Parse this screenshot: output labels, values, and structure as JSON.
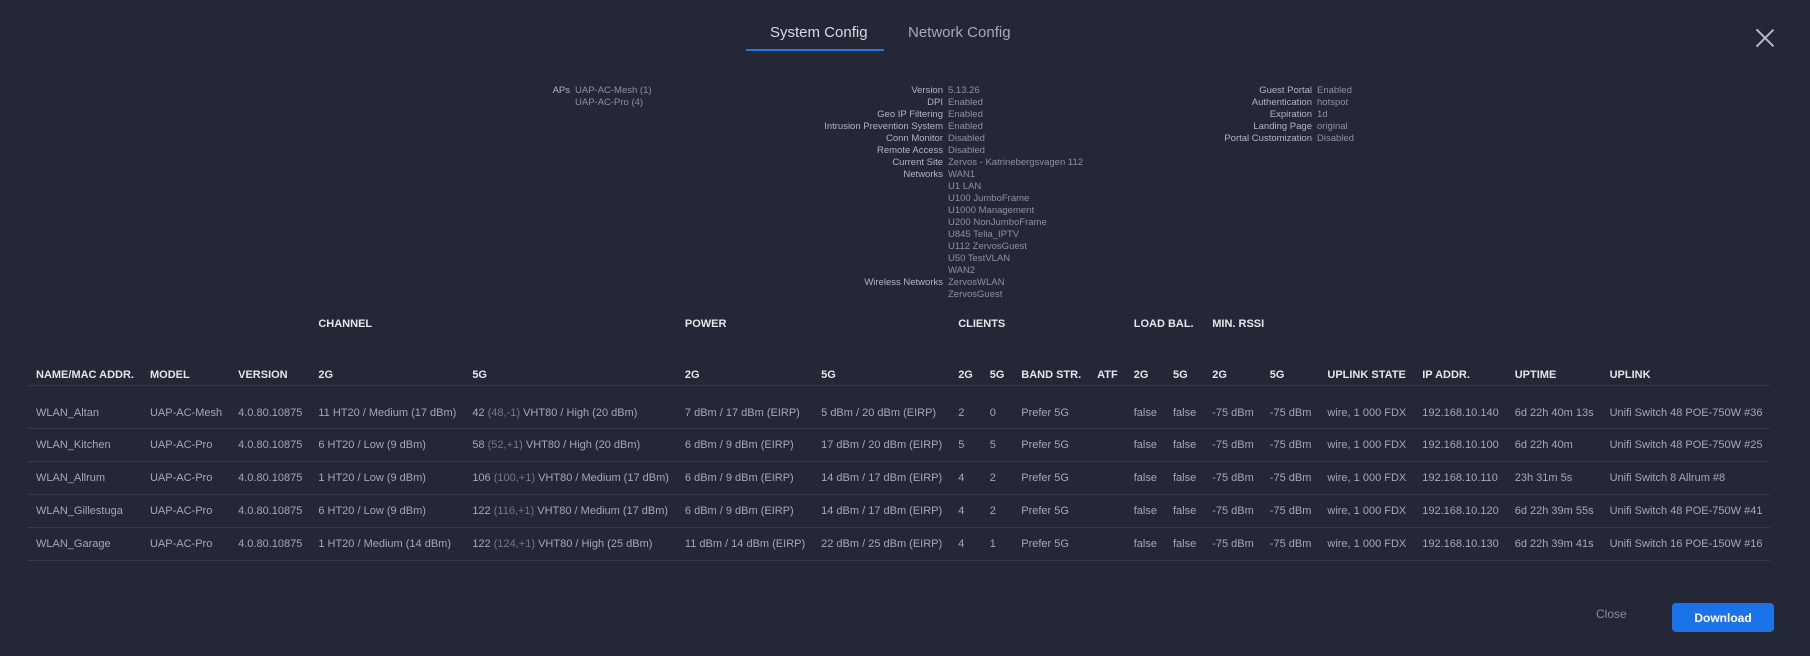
{
  "tabs": {
    "system": "System Config",
    "network": "Network Config"
  },
  "info_left": [
    {
      "key": "APs",
      "values": [
        "UAP-AC-Mesh (1)",
        "UAP-AC-Pro (4)"
      ]
    }
  ],
  "info_middle": [
    {
      "key": "Version",
      "values": [
        "5.13.26"
      ]
    },
    {
      "key": "DPI",
      "values": [
        "Enabled"
      ]
    },
    {
      "key": "Geo IP Filtering",
      "values": [
        "Enabled"
      ]
    },
    {
      "key": "Intrusion Prevention System",
      "values": [
        "Enabled"
      ]
    },
    {
      "key": "Conn Monitor",
      "values": [
        "Disabled"
      ]
    },
    {
      "key": "Remote Access",
      "values": [
        "Disabled"
      ]
    },
    {
      "key": "Current Site",
      "values": [
        "Zervos - Katrinebergsvagen 112"
      ]
    },
    {
      "key": "Networks",
      "values": [
        "WAN1",
        "U1 LAN",
        "U100 JumboFrame",
        "U1000 Management",
        "U200 NonJumboFrame",
        "U845 Telia_IPTV",
        "U112 ZervosGuest",
        "U50 TestVLAN",
        "WAN2"
      ]
    },
    {
      "key": "Wireless Networks",
      "values": [
        "ZervosWLAN",
        "ZervosGuest"
      ]
    }
  ],
  "info_right": [
    {
      "key": "Guest Portal",
      "values": [
        "Enabled"
      ]
    },
    {
      "key": "Authentication",
      "values": [
        "hotspot"
      ]
    },
    {
      "key": "Expiration",
      "values": [
        "1d"
      ]
    },
    {
      "key": "Landing Page",
      "values": [
        "original"
      ]
    },
    {
      "key": "Portal Customization",
      "values": [
        "Disabled"
      ]
    }
  ],
  "table": {
    "group_headers": {
      "channel": "CHANNEL",
      "power": "POWER",
      "clients": "CLIENTS",
      "load_bal": "LOAD BAL.",
      "min_rssi": "MIN. RSSI"
    },
    "columns": [
      "NAME/MAC ADDR.",
      "MODEL",
      "VERSION",
      "2G",
      "5G",
      "2G",
      "5G",
      "2G",
      "5G",
      "BAND STR.",
      "ATF",
      "2G",
      "5G",
      "2G",
      "5G",
      "UPLINK STATE",
      "IP ADDR.",
      "UPTIME",
      "UPLINK"
    ],
    "rows": [
      {
        "name": "WLAN_Altan",
        "model": "UAP-AC-Mesh",
        "version": "4.0.80.10875",
        "ch2g": "11 HT20  / Medium (17 dBm)",
        "ch5g_num": "42",
        "ch5g_ext": "(48,-1)",
        "ch5g_rest": "VHT80  / High (20 dBm)",
        "pw2g": "7 dBm / 17 dBm (EIRP)",
        "pw5g": "5 dBm / 20 dBm (EIRP)",
        "cl2g": "2",
        "cl5g": "0",
        "band": "Prefer 5G",
        "atf": "",
        "lb2g": "false",
        "lb5g": "false",
        "rs2g": "-75 dBm",
        "rs5g": "-75 dBm",
        "uplink_state": "wire, 1 000 FDX",
        "ip": "192.168.10.140",
        "uptime": "6d 22h 40m 13s",
        "uplink": "Unifi Switch 48 POE-750W #36"
      },
      {
        "name": "WLAN_Kitchen",
        "model": "UAP-AC-Pro",
        "version": "4.0.80.10875",
        "ch2g": "6 HT20  / Low (9 dBm)",
        "ch5g_num": "58",
        "ch5g_ext": "(52,+1)",
        "ch5g_rest": "VHT80  / High (20 dBm)",
        "pw2g": "6 dBm / 9 dBm (EIRP)",
        "pw5g": "17 dBm / 20 dBm (EIRP)",
        "cl2g": "5",
        "cl5g": "5",
        "band": "Prefer 5G",
        "atf": "",
        "lb2g": "false",
        "lb5g": "false",
        "rs2g": "-75 dBm",
        "rs5g": "-75 dBm",
        "uplink_state": "wire, 1 000 FDX",
        "ip": "192.168.10.100",
        "uptime": "6d 22h 40m",
        "uplink": "Unifi Switch 48 POE-750W #25"
      },
      {
        "name": "WLAN_Allrum",
        "model": "UAP-AC-Pro",
        "version": "4.0.80.10875",
        "ch2g": "1 HT20  / Low (9 dBm)",
        "ch5g_num": "106",
        "ch5g_ext": "(100,+1)",
        "ch5g_rest": "VHT80  / Medium (17 dBm)",
        "pw2g": "6 dBm / 9 dBm (EIRP)",
        "pw5g": "14 dBm / 17 dBm (EIRP)",
        "cl2g": "4",
        "cl5g": "2",
        "band": "Prefer 5G",
        "atf": "",
        "lb2g": "false",
        "lb5g": "false",
        "rs2g": "-75 dBm",
        "rs5g": "-75 dBm",
        "uplink_state": "wire, 1 000 FDX",
        "ip": "192.168.10.110",
        "uptime": "23h 31m 5s",
        "uplink": "Unifi Switch 8 Allrum #8"
      },
      {
        "name": "WLAN_Gillestuga",
        "model": "UAP-AC-Pro",
        "version": "4.0.80.10875",
        "ch2g": "6 HT20  / Low (9 dBm)",
        "ch5g_num": "122",
        "ch5g_ext": "(116,+1)",
        "ch5g_rest": "VHT80  / Medium (17 dBm)",
        "pw2g": "6 dBm / 9 dBm (EIRP)",
        "pw5g": "14 dBm / 17 dBm (EIRP)",
        "cl2g": "4",
        "cl5g": "2",
        "band": "Prefer 5G",
        "atf": "",
        "lb2g": "false",
        "lb5g": "false",
        "rs2g": "-75 dBm",
        "rs5g": "-75 dBm",
        "uplink_state": "wire, 1 000 FDX",
        "ip": "192.168.10.120",
        "uptime": "6d 22h 39m 55s",
        "uplink": "Unifi Switch 48 POE-750W #41"
      },
      {
        "name": "WLAN_Garage",
        "model": "UAP-AC-Pro",
        "version": "4.0.80.10875",
        "ch2g": "1 HT20  / Medium (14 dBm)",
        "ch5g_num": "122",
        "ch5g_ext": "(124,+1)",
        "ch5g_rest": "VHT80  / High (25 dBm)",
        "pw2g": "11 dBm / 14 dBm (EIRP)",
        "pw5g": "22 dBm / 25 dBm (EIRP)",
        "cl2g": "4",
        "cl5g": "1",
        "band": "Prefer 5G",
        "atf": "",
        "lb2g": "false",
        "lb5g": "false",
        "rs2g": "-75 dBm",
        "rs5g": "-75 dBm",
        "uplink_state": "wire, 1 000 FDX",
        "ip": "192.168.10.130",
        "uptime": "6d 22h 39m 41s",
        "uplink": "Unifi Switch 16 POE-150W #16"
      }
    ]
  },
  "footer": {
    "close_label": "Close",
    "download_label": "Download"
  },
  "colors": {
    "background": "#232736",
    "accent": "#1a73e8"
  },
  "icons": {
    "close": "close-icon"
  }
}
